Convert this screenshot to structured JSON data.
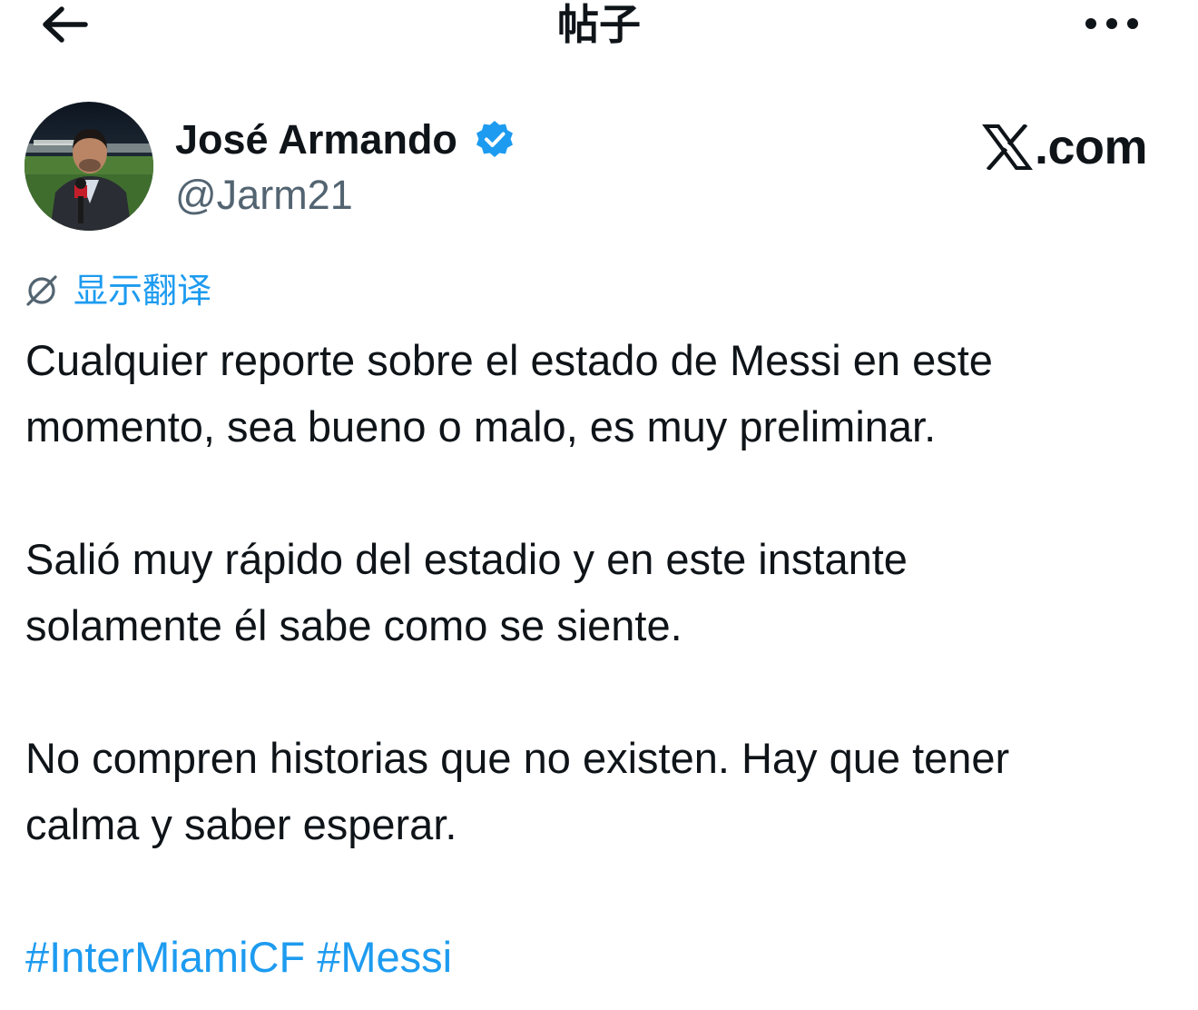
{
  "header": {
    "title": "帖子",
    "back_icon": "arrow-left-icon",
    "more_icon": "more-horizontal-icon"
  },
  "author": {
    "name": "José Armando",
    "handle": "@Jarm21",
    "verified": true,
    "verified_color": "#1d9bf0"
  },
  "brand": {
    "domain": ".com",
    "logo_icon": "x-logo-icon"
  },
  "translate": {
    "label": "显示翻译",
    "icon": "translate-icon"
  },
  "tweet": {
    "paragraphs": [
      "Cualquier reporte sobre el estado de Messi en este\nmomento, sea bueno o malo, es muy preliminar.",
      "Salió muy rápido del estadio y en este instante\nsolamente él sabe como se siente.",
      "No compren historias que no existen. Hay que tener\ncalma y saber esperar."
    ],
    "hashtags": [
      "#InterMiamiCF",
      "#Messi"
    ]
  },
  "colors": {
    "text": "#0f1419",
    "secondary_text": "#536471",
    "accent": "#1d9bf0",
    "background": "#ffffff"
  }
}
